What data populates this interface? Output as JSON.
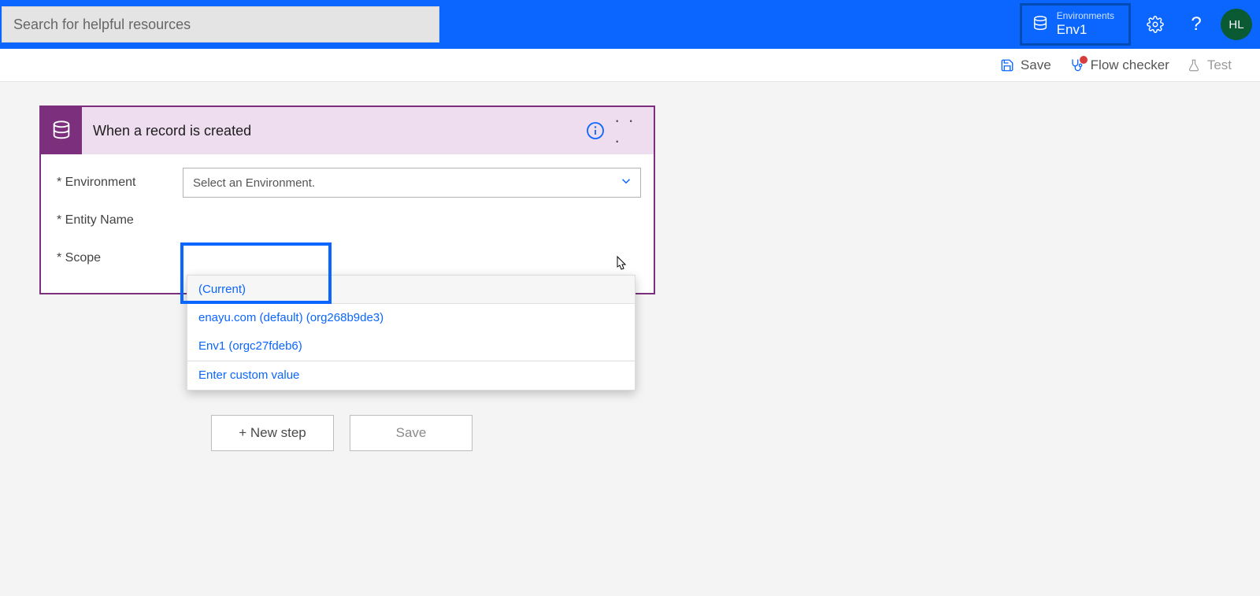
{
  "header": {
    "search_placeholder": "Search for helpful resources",
    "environments_label": "Environments",
    "environment_name": "Env1",
    "avatar_initials": "HL"
  },
  "toolbar": {
    "save_label": "Save",
    "flow_checker_label": "Flow checker",
    "test_label": "Test"
  },
  "trigger": {
    "title": "When a record is created",
    "fields": {
      "environment_label": "* Environment",
      "entity_label": "* Entity Name",
      "scope_label": "* Scope",
      "environment_placeholder": "Select an Environment."
    },
    "dropdown_options": [
      "(Current)",
      "enayu.com (default) (org268b9de3)",
      "Env1 (orgc27fdeb6)"
    ],
    "dropdown_custom": "Enter custom value"
  },
  "buttons": {
    "new_step": "+ New step",
    "save": "Save"
  },
  "colors": {
    "accent": "#0b65ff",
    "trigger": "#7b2f7d",
    "trigger_bg": "#eedcef",
    "avatar_bg": "#0a5a34"
  }
}
